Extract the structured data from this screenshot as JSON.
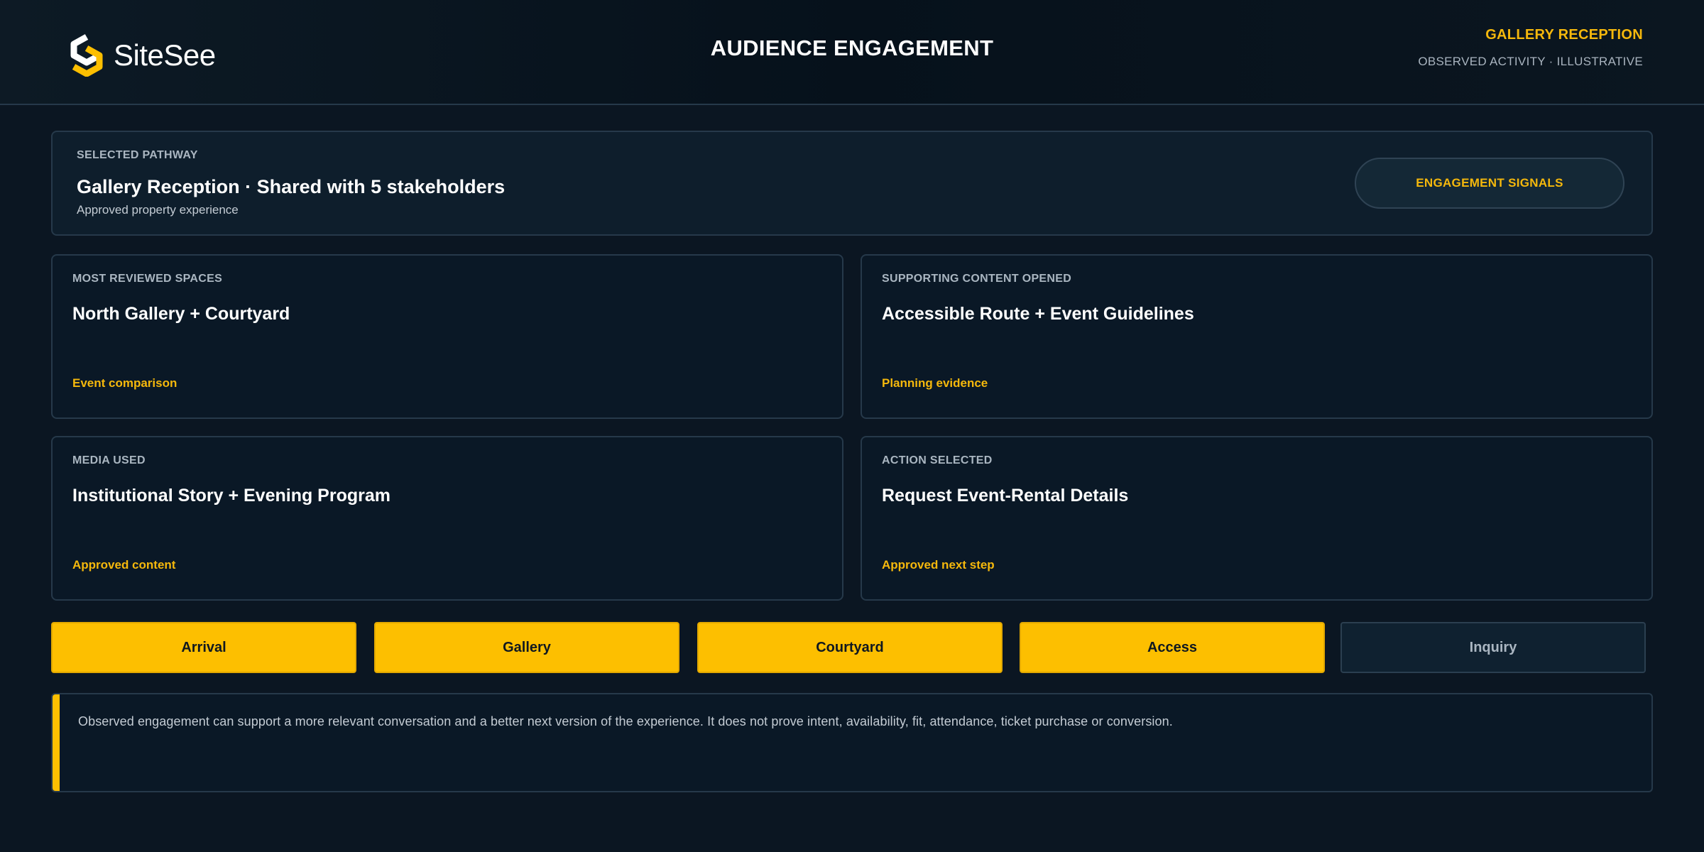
{
  "header": {
    "brand": "SiteSee",
    "title": "AUDIENCE ENGAGEMENT",
    "context_label": "GALLERY RECEPTION",
    "context_sub": "OBSERVED ACTIVITY · ILLUSTRATIVE"
  },
  "pathway": {
    "eyebrow": "SELECTED PATHWAY",
    "title": "Gallery Reception · Shared with 5 stakeholders",
    "subtitle": "Approved property experience",
    "button_label": "ENGAGEMENT SIGNALS"
  },
  "cards": [
    {
      "eyebrow": "MOST REVIEWED SPACES",
      "value": "North Gallery + Courtyard",
      "tag": "Event comparison"
    },
    {
      "eyebrow": "SUPPORTING CONTENT OPENED",
      "value": "Accessible Route + Event Guidelines",
      "tag": "Planning evidence"
    },
    {
      "eyebrow": "MEDIA USED",
      "value": "Institutional Story + Evening Program",
      "tag": "Approved content"
    },
    {
      "eyebrow": "ACTION SELECTED",
      "value": "Request Event-Rental Details",
      "tag": "Approved next step"
    }
  ],
  "steps": [
    {
      "label": "Arrival",
      "active": true
    },
    {
      "label": "Gallery",
      "active": true
    },
    {
      "label": "Courtyard",
      "active": true
    },
    {
      "label": "Access",
      "active": true
    },
    {
      "label": "Inquiry",
      "active": false
    }
  ],
  "note": {
    "text": "Observed engagement can support a more relevant conversation and a better next version of the experience. It does not prove intent, availability, fit, attendance, ticket purchase or conversion."
  },
  "colors": {
    "accent": "#fdbf00",
    "background": "#0b1622",
    "panel": "#0a1826"
  },
  "icons": {
    "logo": "sitesee-logo-icon"
  }
}
